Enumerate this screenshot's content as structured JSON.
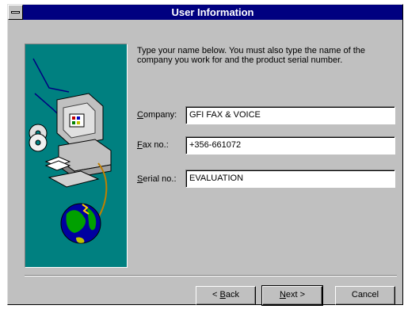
{
  "window": {
    "title": "User Information"
  },
  "instructions": "Type your name below. You must also type the name of the company you work for and the product serial number.",
  "fields": {
    "company": {
      "label_mnemonic": "C",
      "label_rest": "ompany:",
      "value": "GFI FAX & VOICE"
    },
    "fax": {
      "label_mnemonic": "F",
      "label_rest": "ax no.:",
      "value": "+356-661072"
    },
    "serial": {
      "label_mnemonic": "S",
      "label_rest": "erial no.:",
      "value": "EVALUATION"
    }
  },
  "buttons": {
    "back": {
      "prefix": "< ",
      "mnemonic": "B",
      "rest": "ack"
    },
    "next": {
      "mnemonic": "N",
      "rest": "ext >"
    },
    "cancel": {
      "label": "Cancel"
    }
  },
  "colors": {
    "title_bar": "#000080",
    "dialog_face": "#c0c0c0",
    "art_background": "#008080"
  },
  "icons": [
    "system-menu-icon",
    "computer-illustration",
    "cd-disc-icon",
    "floppy-disk-icon",
    "globe-icon"
  ]
}
